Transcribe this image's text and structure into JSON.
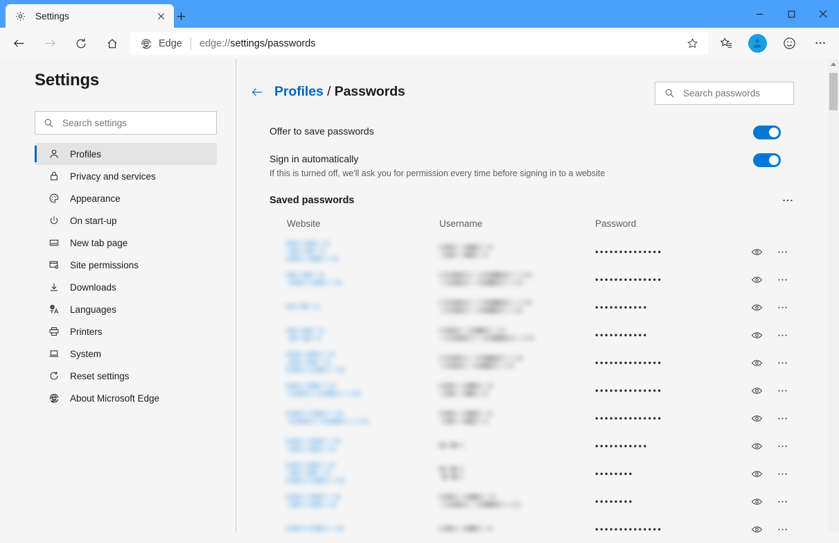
{
  "window": {
    "minimize_label": "─",
    "maximize_label": "□",
    "close_label": "✕"
  },
  "tabstrip": {
    "tab_title": "Settings",
    "tab_icon": "gear-icon",
    "close_label": "✕",
    "new_tab_label": "+"
  },
  "toolbar": {
    "back_label": "←",
    "forward_label": "→",
    "refresh_label": "↻",
    "home_label": "⌂",
    "brand_name": "Edge",
    "url_prefix": "edge://",
    "url_highlight": "settings/passwords",
    "favorite_icon": "star-add-icon",
    "collections_icon": "favorites-list-icon",
    "profile_icon": "profile-avatar",
    "feedback_icon": "smiley-icon",
    "more_label": "···"
  },
  "sidebar": {
    "title": "Settings",
    "search": {
      "placeholder": "Search settings",
      "value": "",
      "icon": "search-icon"
    },
    "items": [
      {
        "label": "Profiles",
        "icon": "person-icon",
        "selected": true
      },
      {
        "label": "Privacy and services",
        "icon": "lock-icon",
        "selected": false
      },
      {
        "label": "Appearance",
        "icon": "palette-icon",
        "selected": false
      },
      {
        "label": "On start-up",
        "icon": "power-icon",
        "selected": false
      },
      {
        "label": "New tab page",
        "icon": "newtab-icon",
        "selected": false
      },
      {
        "label": "Site permissions",
        "icon": "site-permissions-icon",
        "selected": false
      },
      {
        "label": "Downloads",
        "icon": "download-icon",
        "selected": false
      },
      {
        "label": "Languages",
        "icon": "languages-icon",
        "selected": false
      },
      {
        "label": "Printers",
        "icon": "printer-icon",
        "selected": false
      },
      {
        "label": "System",
        "icon": "laptop-icon",
        "selected": false
      },
      {
        "label": "Reset settings",
        "icon": "reset-icon",
        "selected": false
      },
      {
        "label": "About Microsoft Edge",
        "icon": "edge-logo-icon",
        "selected": false
      }
    ]
  },
  "main": {
    "breadcrumb": {
      "parent": "Profiles",
      "separator": "/",
      "current": "Passwords",
      "back_icon": "back-arrow-icon"
    },
    "search": {
      "placeholder": "Search passwords",
      "value": "",
      "icon": "search-icon"
    },
    "settings": [
      {
        "label": "Offer to save passwords",
        "description": "",
        "toggle_on": true
      },
      {
        "label": "Sign in automatically",
        "description": "If this is turned off, we'll ask you for permission every time before signing in to a website",
        "toggle_on": true
      }
    ],
    "saved_section": {
      "title": "Saved passwords",
      "menu_label": "···"
    },
    "table": {
      "columns": [
        "Website",
        "Username",
        "Password"
      ],
      "row_eye_icon": "eye-icon",
      "row_menu_label": "···",
      "rows": [
        {
          "website": "",
          "username": "",
          "password_mask": "••••••••••••••",
          "website_redacted": true,
          "username_redacted": true,
          "website_lines": 3,
          "website_width": 84,
          "username_lines": 2,
          "username_width": 96
        },
        {
          "website": "",
          "username": "",
          "password_mask": "••••••••••••••",
          "website_redacted": true,
          "username_redacted": true,
          "website_lines": 2,
          "website_width": 82,
          "username_lines": 2,
          "username_width": 148
        },
        {
          "website": "",
          "username": "",
          "password_mask": "•••••••••••",
          "website_redacted": true,
          "username_redacted": true,
          "website_lines": 1,
          "website_width": 72,
          "username_lines": 2,
          "username_width": 148
        },
        {
          "website": "",
          "username": "",
          "password_mask": "•••••••••••",
          "website_redacted": true,
          "username_redacted": true,
          "website_lines": 2,
          "website_width": 74,
          "username_lines": 2,
          "username_width": 142
        },
        {
          "website": "",
          "username": "",
          "password_mask": "••••••••••••••",
          "website_redacted": true,
          "username_redacted": true,
          "website_lines": 3,
          "website_width": 94,
          "username_lines": 2,
          "username_width": 146
        },
        {
          "website": "",
          "username": "",
          "password_mask": "••••••••••••••",
          "website_redacted": true,
          "username_redacted": true,
          "website_lines": 2,
          "website_width": 120,
          "username_lines": 2,
          "username_width": 96
        },
        {
          "website": "",
          "username": "",
          "password_mask": "••••••••••••••",
          "website_redacted": true,
          "username_redacted": true,
          "website_lines": 2,
          "website_width": 122,
          "username_lines": 2,
          "username_width": 96
        },
        {
          "website": "",
          "username": "",
          "password_mask": "•••••••••••",
          "website_redacted": true,
          "username_redacted": true,
          "website_lines": 2,
          "website_width": 96,
          "username_lines": 1,
          "username_width": 46
        },
        {
          "website": "",
          "username": "",
          "password_mask": "••••••••",
          "website_redacted": true,
          "username_redacted": true,
          "website_lines": 3,
          "website_width": 94,
          "username_lines": 2,
          "username_width": 46
        },
        {
          "website": "",
          "username": "",
          "password_mask": "••••••••",
          "website_redacted": true,
          "username_redacted": true,
          "website_lines": 2,
          "website_width": 88,
          "username_lines": 2,
          "username_width": 122
        },
        {
          "website": "",
          "username": "",
          "password_mask": "••••••••••••••",
          "website_redacted": true,
          "username_redacted": true,
          "website_lines": 1,
          "website_width": 122,
          "username_lines": 1,
          "username_width": 96
        }
      ]
    }
  },
  "scrollbar": {
    "up_label": "▲",
    "position": "top"
  },
  "colors": {
    "titlebar": "#4aa0fa",
    "accent": "#0078d4",
    "link": "#0067c0",
    "panel_bg": "#f5f5f5",
    "toolbar_bg": "#f7f7f7",
    "selected_item": "#e4e4e4"
  }
}
